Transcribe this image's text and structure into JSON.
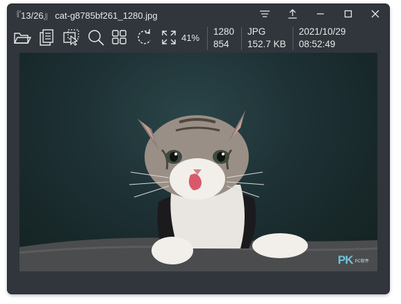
{
  "window": {
    "title": "『13/26』 cat-g8785bf261_1280.jpg",
    "controls": [
      "menu-icon",
      "share-icon",
      "minimize-icon",
      "maximize-icon",
      "close-icon"
    ]
  },
  "toolbar": {
    "tools": [
      "open-folder-icon",
      "copy-icon",
      "crop-select-icon",
      "search-icon",
      "grid-view-icon",
      "rotate-icon",
      "fullscreen-icon"
    ],
    "zoom_level": "41%"
  },
  "file_info": {
    "width": "1280",
    "height": "854",
    "format": "JPG",
    "file_size": "152.7 KB",
    "date": "2021/10/29",
    "time": "08:52:49"
  },
  "image": {
    "description_icon": "cat-photo",
    "watermark_big": "PK",
    "watermark_small": "PC软件"
  },
  "colors": {
    "window_bg": "#30363b",
    "text": "#e6e9eb",
    "accent": "#6ec3d8"
  }
}
